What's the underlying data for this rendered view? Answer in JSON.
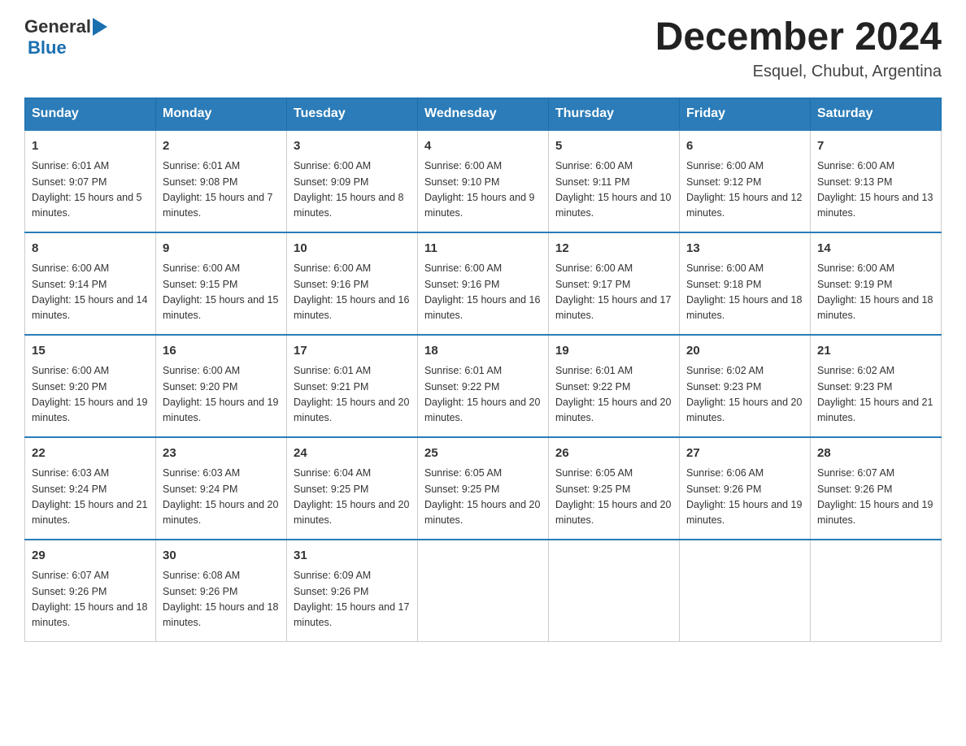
{
  "header": {
    "logo_text_general": "General",
    "logo_text_blue": "Blue",
    "month_title": "December 2024",
    "location": "Esquel, Chubut, Argentina"
  },
  "days_of_week": [
    "Sunday",
    "Monday",
    "Tuesday",
    "Wednesday",
    "Thursday",
    "Friday",
    "Saturday"
  ],
  "weeks": [
    [
      {
        "day": "1",
        "sunrise": "Sunrise: 6:01 AM",
        "sunset": "Sunset: 9:07 PM",
        "daylight": "Daylight: 15 hours and 5 minutes."
      },
      {
        "day": "2",
        "sunrise": "Sunrise: 6:01 AM",
        "sunset": "Sunset: 9:08 PM",
        "daylight": "Daylight: 15 hours and 7 minutes."
      },
      {
        "day": "3",
        "sunrise": "Sunrise: 6:00 AM",
        "sunset": "Sunset: 9:09 PM",
        "daylight": "Daylight: 15 hours and 8 minutes."
      },
      {
        "day": "4",
        "sunrise": "Sunrise: 6:00 AM",
        "sunset": "Sunset: 9:10 PM",
        "daylight": "Daylight: 15 hours and 9 minutes."
      },
      {
        "day": "5",
        "sunrise": "Sunrise: 6:00 AM",
        "sunset": "Sunset: 9:11 PM",
        "daylight": "Daylight: 15 hours and 10 minutes."
      },
      {
        "day": "6",
        "sunrise": "Sunrise: 6:00 AM",
        "sunset": "Sunset: 9:12 PM",
        "daylight": "Daylight: 15 hours and 12 minutes."
      },
      {
        "day": "7",
        "sunrise": "Sunrise: 6:00 AM",
        "sunset": "Sunset: 9:13 PM",
        "daylight": "Daylight: 15 hours and 13 minutes."
      }
    ],
    [
      {
        "day": "8",
        "sunrise": "Sunrise: 6:00 AM",
        "sunset": "Sunset: 9:14 PM",
        "daylight": "Daylight: 15 hours and 14 minutes."
      },
      {
        "day": "9",
        "sunrise": "Sunrise: 6:00 AM",
        "sunset": "Sunset: 9:15 PM",
        "daylight": "Daylight: 15 hours and 15 minutes."
      },
      {
        "day": "10",
        "sunrise": "Sunrise: 6:00 AM",
        "sunset": "Sunset: 9:16 PM",
        "daylight": "Daylight: 15 hours and 16 minutes."
      },
      {
        "day": "11",
        "sunrise": "Sunrise: 6:00 AM",
        "sunset": "Sunset: 9:16 PM",
        "daylight": "Daylight: 15 hours and 16 minutes."
      },
      {
        "day": "12",
        "sunrise": "Sunrise: 6:00 AM",
        "sunset": "Sunset: 9:17 PM",
        "daylight": "Daylight: 15 hours and 17 minutes."
      },
      {
        "day": "13",
        "sunrise": "Sunrise: 6:00 AM",
        "sunset": "Sunset: 9:18 PM",
        "daylight": "Daylight: 15 hours and 18 minutes."
      },
      {
        "day": "14",
        "sunrise": "Sunrise: 6:00 AM",
        "sunset": "Sunset: 9:19 PM",
        "daylight": "Daylight: 15 hours and 18 minutes."
      }
    ],
    [
      {
        "day": "15",
        "sunrise": "Sunrise: 6:00 AM",
        "sunset": "Sunset: 9:20 PM",
        "daylight": "Daylight: 15 hours and 19 minutes."
      },
      {
        "day": "16",
        "sunrise": "Sunrise: 6:00 AM",
        "sunset": "Sunset: 9:20 PM",
        "daylight": "Daylight: 15 hours and 19 minutes."
      },
      {
        "day": "17",
        "sunrise": "Sunrise: 6:01 AM",
        "sunset": "Sunset: 9:21 PM",
        "daylight": "Daylight: 15 hours and 20 minutes."
      },
      {
        "day": "18",
        "sunrise": "Sunrise: 6:01 AM",
        "sunset": "Sunset: 9:22 PM",
        "daylight": "Daylight: 15 hours and 20 minutes."
      },
      {
        "day": "19",
        "sunrise": "Sunrise: 6:01 AM",
        "sunset": "Sunset: 9:22 PM",
        "daylight": "Daylight: 15 hours and 20 minutes."
      },
      {
        "day": "20",
        "sunrise": "Sunrise: 6:02 AM",
        "sunset": "Sunset: 9:23 PM",
        "daylight": "Daylight: 15 hours and 20 minutes."
      },
      {
        "day": "21",
        "sunrise": "Sunrise: 6:02 AM",
        "sunset": "Sunset: 9:23 PM",
        "daylight": "Daylight: 15 hours and 21 minutes."
      }
    ],
    [
      {
        "day": "22",
        "sunrise": "Sunrise: 6:03 AM",
        "sunset": "Sunset: 9:24 PM",
        "daylight": "Daylight: 15 hours and 21 minutes."
      },
      {
        "day": "23",
        "sunrise": "Sunrise: 6:03 AM",
        "sunset": "Sunset: 9:24 PM",
        "daylight": "Daylight: 15 hours and 20 minutes."
      },
      {
        "day": "24",
        "sunrise": "Sunrise: 6:04 AM",
        "sunset": "Sunset: 9:25 PM",
        "daylight": "Daylight: 15 hours and 20 minutes."
      },
      {
        "day": "25",
        "sunrise": "Sunrise: 6:05 AM",
        "sunset": "Sunset: 9:25 PM",
        "daylight": "Daylight: 15 hours and 20 minutes."
      },
      {
        "day": "26",
        "sunrise": "Sunrise: 6:05 AM",
        "sunset": "Sunset: 9:25 PM",
        "daylight": "Daylight: 15 hours and 20 minutes."
      },
      {
        "day": "27",
        "sunrise": "Sunrise: 6:06 AM",
        "sunset": "Sunset: 9:26 PM",
        "daylight": "Daylight: 15 hours and 19 minutes."
      },
      {
        "day": "28",
        "sunrise": "Sunrise: 6:07 AM",
        "sunset": "Sunset: 9:26 PM",
        "daylight": "Daylight: 15 hours and 19 minutes."
      }
    ],
    [
      {
        "day": "29",
        "sunrise": "Sunrise: 6:07 AM",
        "sunset": "Sunset: 9:26 PM",
        "daylight": "Daylight: 15 hours and 18 minutes."
      },
      {
        "day": "30",
        "sunrise": "Sunrise: 6:08 AM",
        "sunset": "Sunset: 9:26 PM",
        "daylight": "Daylight: 15 hours and 18 minutes."
      },
      {
        "day": "31",
        "sunrise": "Sunrise: 6:09 AM",
        "sunset": "Sunset: 9:26 PM",
        "daylight": "Daylight: 15 hours and 17 minutes."
      },
      null,
      null,
      null,
      null
    ]
  ]
}
